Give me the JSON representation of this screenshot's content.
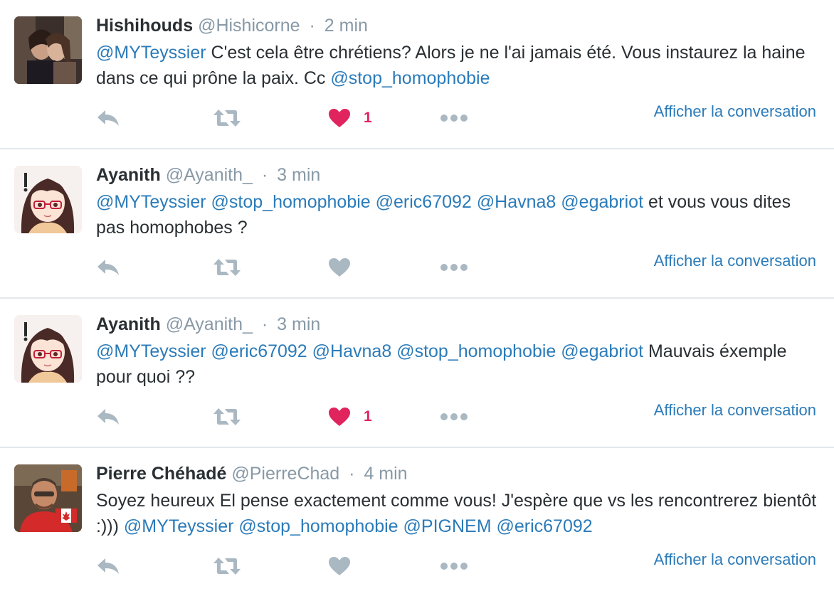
{
  "colors": {
    "link": "#2b7bb9",
    "muted": "#8899a6",
    "like_active": "#e0245e",
    "icon": "#aab8c2"
  },
  "tweets": [
    {
      "name": "Hishihouds",
      "handle": "@Hishicorne",
      "separator": "·",
      "time": "2 min",
      "avatar": "avatar-photo-couple",
      "text_parts": [
        {
          "t": "@MYTeyssier",
          "m": true
        },
        {
          "t": " C'est cela être chrétiens? Alors je ne l'ai jamais été. Vous instaurez la haine dans ce qui prône la paix. Cc ",
          "m": false
        },
        {
          "t": "@stop_homophobie",
          "m": true
        }
      ],
      "liked": true,
      "like_count": "1",
      "conversation": "Afficher la conversation"
    },
    {
      "name": "Ayanith",
      "handle": "@Ayanith_",
      "separator": "·",
      "time": "3 min",
      "avatar": "avatar-anime-girl",
      "text_parts": [
        {
          "t": "@MYTeyssier",
          "m": true
        },
        {
          "t": " ",
          "m": false
        },
        {
          "t": "@stop_homophobie",
          "m": true
        },
        {
          "t": " ",
          "m": false
        },
        {
          "t": "@eric67092",
          "m": true
        },
        {
          "t": " ",
          "m": false
        },
        {
          "t": "@Havna8",
          "m": true
        },
        {
          "t": " ",
          "m": false
        },
        {
          "t": "@egabriot",
          "m": true
        },
        {
          "t": " et vous vous dites pas homophobes ?",
          "m": false
        }
      ],
      "liked": false,
      "like_count": "",
      "conversation": "Afficher la conversation"
    },
    {
      "name": "Ayanith",
      "handle": "@Ayanith_",
      "separator": "·",
      "time": "3 min",
      "avatar": "avatar-anime-girl",
      "text_parts": [
        {
          "t": "@MYTeyssier",
          "m": true
        },
        {
          "t": " ",
          "m": false
        },
        {
          "t": "@eric67092",
          "m": true
        },
        {
          "t": " ",
          "m": false
        },
        {
          "t": "@Havna8",
          "m": true
        },
        {
          "t": " ",
          "m": false
        },
        {
          "t": "@stop_homophobie",
          "m": true
        },
        {
          "t": " ",
          "m": false
        },
        {
          "t": "@egabriot",
          "m": true
        },
        {
          "t": " Mauvais éxemple pour quoi ??",
          "m": false
        }
      ],
      "liked": true,
      "like_count": "1",
      "conversation": "Afficher la conversation"
    },
    {
      "name": "Pierre Chéhadé",
      "handle": "@PierreChad",
      "separator": "·",
      "time": "4 min",
      "avatar": "avatar-photo-man-flag",
      "text_parts": [
        {
          "t": "Soyez heureux El pense exactement comme vous! J'espère que vs les rencontrerez bientôt :))) ",
          "m": false
        },
        {
          "t": "@MYTeyssier",
          "m": true
        },
        {
          "t": " ",
          "m": false
        },
        {
          "t": "@stop_homophobie",
          "m": true
        },
        {
          "t": " ",
          "m": false
        },
        {
          "t": "@PIGNEM",
          "m": true
        },
        {
          "t": " ",
          "m": false
        },
        {
          "t": "@eric67092",
          "m": true
        }
      ],
      "liked": false,
      "like_count": "",
      "conversation": "Afficher la conversation"
    }
  ]
}
